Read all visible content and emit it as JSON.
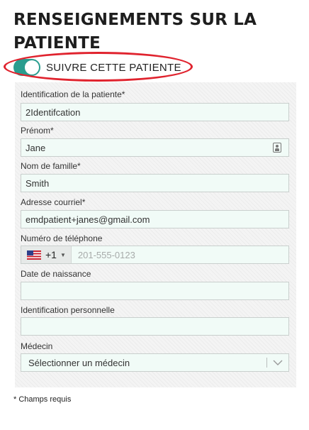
{
  "page": {
    "title": "RENSEIGNEMENTS SUR LA PATIENTE",
    "follow_toggle": {
      "label": "SUIVRE CETTE PATIENTE",
      "on": true
    },
    "required_note": "* Champs requis"
  },
  "colors": {
    "toggle_on": "#2a9d8f",
    "highlight_ring": "#e0232e",
    "field_background": "#f1fbf7"
  },
  "form": {
    "patient_id": {
      "label": "Identification de la patiente*",
      "value": "2Identifcation"
    },
    "first_name": {
      "label": "Prénom*",
      "value": "Jane",
      "icon": "contact-card-icon"
    },
    "last_name": {
      "label": "Nom de famille*",
      "value": "Smith"
    },
    "email": {
      "label": "Adresse courriel*",
      "value": "emdpatient+janes@gmail.com"
    },
    "phone": {
      "label": "Numéro de téléphone",
      "country_flag": "us-flag-icon",
      "dial_code": "+1",
      "placeholder": "201-555-0123"
    },
    "birth_date": {
      "label": "Date de naissance",
      "value": ""
    },
    "personal_id": {
      "label": "Identification personnelle",
      "value": ""
    },
    "doctor": {
      "label": "Médecin",
      "selected": "Sélectionner un médecin"
    }
  }
}
